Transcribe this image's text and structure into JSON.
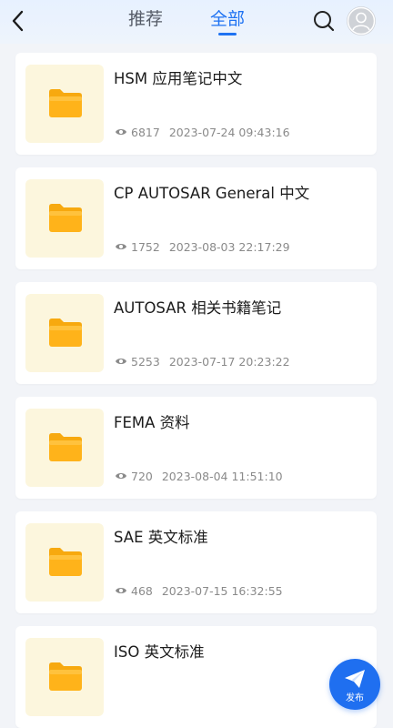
{
  "header": {
    "tabs": [
      {
        "label": "推荐",
        "active": false
      },
      {
        "label": "全部",
        "active": true
      }
    ],
    "accent_color": "#1e72f2"
  },
  "items": [
    {
      "title": "HSM 应用笔记中文",
      "views": "6817",
      "datetime": "2023-07-24 09:43:16"
    },
    {
      "title": "CP AUTOSAR General 中文",
      "views": "1752",
      "datetime": "2023-08-03 22:17:29"
    },
    {
      "title": "AUTOSAR 相关书籍笔记",
      "views": "5253",
      "datetime": "2023-07-17 20:23:22"
    },
    {
      "title": "FEMA 资料",
      "views": "720",
      "datetime": "2023-08-04 11:51:10"
    },
    {
      "title": "SAE 英文标准",
      "views": "468",
      "datetime": "2023-07-15 16:32:55"
    },
    {
      "title": "ISO 英文标准",
      "views": "",
      "datetime": ""
    }
  ],
  "fab": {
    "label": "发布"
  },
  "icons": {
    "back": "chevron-left-icon",
    "search": "search-icon",
    "avatar": "user-avatar-icon",
    "folder": "folder-icon",
    "views": "eye-icon",
    "publish": "paper-plane-icon"
  },
  "colors": {
    "folder": "#ffb31a",
    "thumb_bg": "#fcf6dd",
    "fab": "#1f6ff0"
  }
}
